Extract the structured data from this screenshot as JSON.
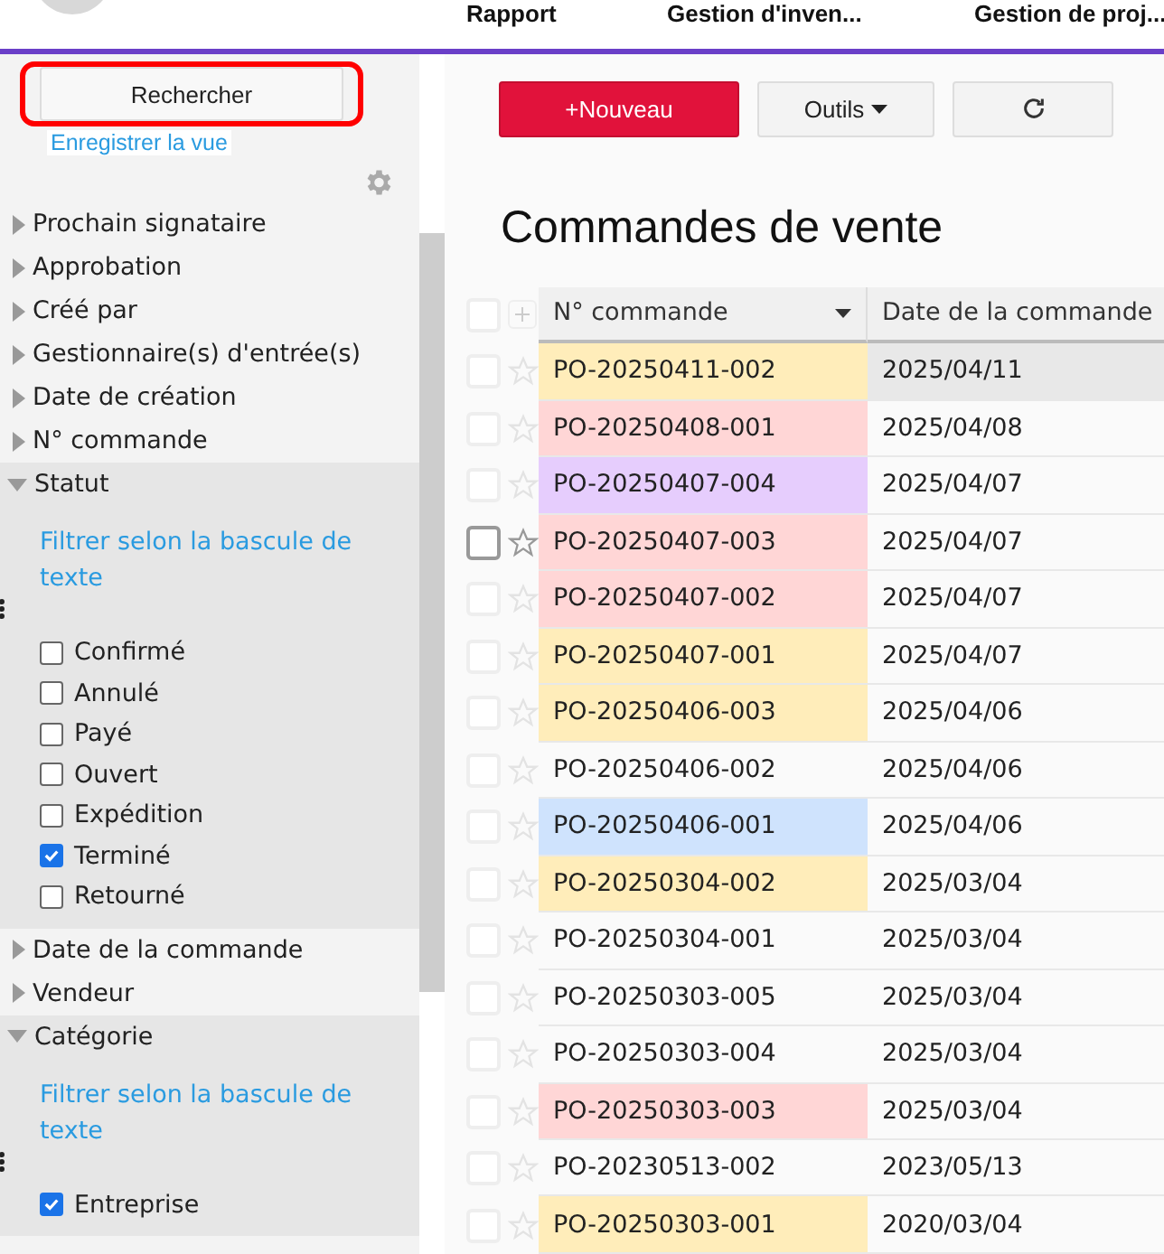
{
  "nav": {
    "items": [
      "Rapport",
      "Gestion d'inven...",
      "Gestion de proj..."
    ]
  },
  "sidebar": {
    "search_button": "Rechercher",
    "save_view_link": "Enregistrer la vue",
    "filters": [
      {
        "label": "Prochain signataire",
        "expanded": false
      },
      {
        "label": "Approbation",
        "expanded": false
      },
      {
        "label": "Créé par",
        "expanded": false
      },
      {
        "label": "Gestionnaire(s) d'entrée(s)",
        "expanded": false
      },
      {
        "label": "Date de création",
        "expanded": false
      },
      {
        "label": "N° commande",
        "expanded": false
      },
      {
        "label": "Statut",
        "expanded": true,
        "toggle_link": "Filtrer selon la bascule de texte",
        "options": [
          {
            "label": "Confirmé",
            "checked": false
          },
          {
            "label": "Annulé",
            "checked": false
          },
          {
            "label": "Payé",
            "checked": false
          },
          {
            "label": "Ouvert",
            "checked": false
          },
          {
            "label": "Expédition",
            "checked": false
          },
          {
            "label": "Terminé",
            "checked": true
          },
          {
            "label": "Retourné",
            "checked": false
          }
        ]
      },
      {
        "label": "Date de la commande",
        "expanded": false
      },
      {
        "label": "Vendeur",
        "expanded": false
      },
      {
        "label": "Catégorie",
        "expanded": true,
        "toggle_link": "Filtrer selon la bascule de texte",
        "options": [
          {
            "label": "Entreprise",
            "checked": true
          }
        ]
      }
    ]
  },
  "toolbar": {
    "new_button": "+Nouveau",
    "tools_button": "Outils"
  },
  "title": "Commandes de vente",
  "table": {
    "select_all_checked": false,
    "columns": [
      "N° commande",
      "Date de la commande"
    ],
    "rows": [
      {
        "number": "PO-20250411-002",
        "date": "2025/04/11",
        "color": "#ffedba",
        "checked": false,
        "hovered": false,
        "highlighted": true
      },
      {
        "number": "PO-20250408-001",
        "date": "2025/04/08",
        "color": "#ffd6d6",
        "checked": false,
        "hovered": false,
        "highlighted": false
      },
      {
        "number": "PO-20250407-004",
        "date": "2025/04/07",
        "color": "#e6cdfd",
        "checked": false,
        "hovered": false,
        "highlighted": false
      },
      {
        "number": "PO-20250407-003",
        "date": "2025/04/07",
        "color": "#ffd6d6",
        "checked": false,
        "hovered": true,
        "highlighted": false
      },
      {
        "number": "PO-20250407-002",
        "date": "2025/04/07",
        "color": "#ffd6d6",
        "checked": false,
        "hovered": false,
        "highlighted": false
      },
      {
        "number": "PO-20250407-001",
        "date": "2025/04/07",
        "color": "#ffedba",
        "checked": false,
        "hovered": false,
        "highlighted": false
      },
      {
        "number": "PO-20250406-003",
        "date": "2025/04/06",
        "color": "#ffedba",
        "checked": false,
        "hovered": false,
        "highlighted": false
      },
      {
        "number": "PO-20250406-002",
        "date": "2025/04/06",
        "checked": false,
        "hovered": false,
        "highlighted": false
      },
      {
        "number": "PO-20250406-001",
        "date": "2025/04/06",
        "color": "#cfe3fd",
        "checked": false,
        "hovered": false,
        "highlighted": false
      },
      {
        "number": "PO-20250304-002",
        "date": "2025/03/04",
        "color": "#ffedba",
        "checked": false,
        "hovered": false,
        "highlighted": false
      },
      {
        "number": "PO-20250304-001",
        "date": "2025/03/04",
        "checked": false,
        "hovered": false,
        "highlighted": false
      },
      {
        "number": "PO-20250303-005",
        "date": "2025/03/04",
        "checked": false,
        "hovered": false,
        "highlighted": false
      },
      {
        "number": "PO-20250303-004",
        "date": "2025/03/04",
        "checked": false,
        "hovered": false,
        "highlighted": false
      },
      {
        "number": "PO-20250303-003",
        "date": "2025/03/04",
        "color": "#ffd6d6",
        "checked": false,
        "hovered": false,
        "highlighted": false
      },
      {
        "number": "PO-20230513-002",
        "date": "2023/05/13",
        "checked": false,
        "hovered": false,
        "highlighted": false
      },
      {
        "number": "PO-20250303-001",
        "date": "2020/03/04",
        "color": "#ffedba",
        "checked": false,
        "hovered": false,
        "highlighted": false
      }
    ]
  }
}
